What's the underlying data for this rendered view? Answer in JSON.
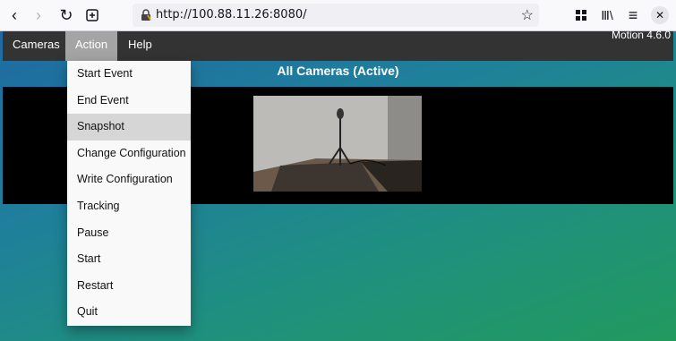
{
  "browser": {
    "url": "http://100.88.11.26:8080/",
    "icons": [
      "back-icon",
      "forward-icon",
      "reload-icon",
      "new-tab-icon",
      "lock-icon",
      "star-icon",
      "extensions-icon",
      "library-icon",
      "menu-icon",
      "close-icon"
    ]
  },
  "app": {
    "nav": {
      "cameras": "Cameras",
      "action": "Action",
      "help": "Help"
    },
    "version": "Motion 4.6.0",
    "section_title": "All Cameras (Active)",
    "action_menu": [
      "Start Event",
      "End Event",
      "Snapshot",
      "Change Configuration",
      "Write Configuration",
      "Tracking",
      "Pause",
      "Start",
      "Restart",
      "Quit"
    ],
    "hovered_item": "Snapshot"
  },
  "colors": {
    "nav_bg": "#333333",
    "nav_active": "#a4a4a4",
    "menu_bg": "#f9f9f9",
    "menu_hover": "#d6d6d6"
  }
}
